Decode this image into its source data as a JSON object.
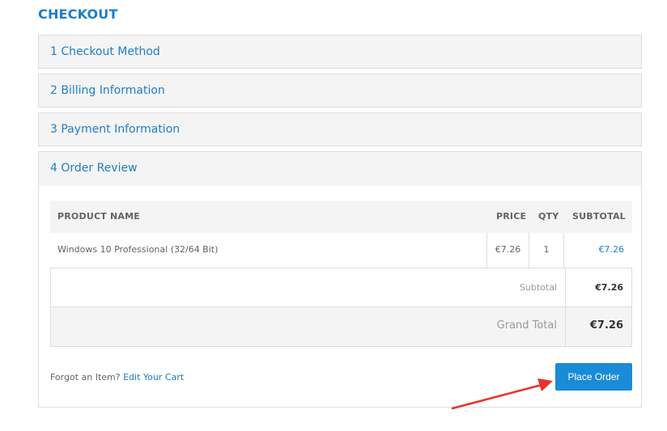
{
  "page": {
    "title": "CHECKOUT"
  },
  "steps": [
    {
      "label": "1 Checkout Method"
    },
    {
      "label": "2 Billing Information"
    },
    {
      "label": "3 Payment Information"
    },
    {
      "label": "4 Order Review"
    }
  ],
  "review": {
    "columns": {
      "product_name": "PRODUCT NAME",
      "price": "PRICE",
      "qty": "QTY",
      "subtotal": "SUBTOTAL"
    },
    "items": [
      {
        "name": "Windows 10 Professional (32/64 Bit)",
        "price": "€7.26",
        "qty": "1",
        "subtotal": "€7.26"
      }
    ],
    "totals": {
      "subtotal_label": "Subtotal",
      "subtotal_value": "€7.26",
      "grand_total_label": "Grand Total",
      "grand_total_value": "€7.26"
    },
    "forgot_text": "Forgot an Item?",
    "edit_cart_link": "Edit Your Cart",
    "place_order_label": "Place Order"
  },
  "colors": {
    "accent": "#1e7ec8",
    "button": "#1a8bd6",
    "annotation_arrow": "#e8322d"
  }
}
